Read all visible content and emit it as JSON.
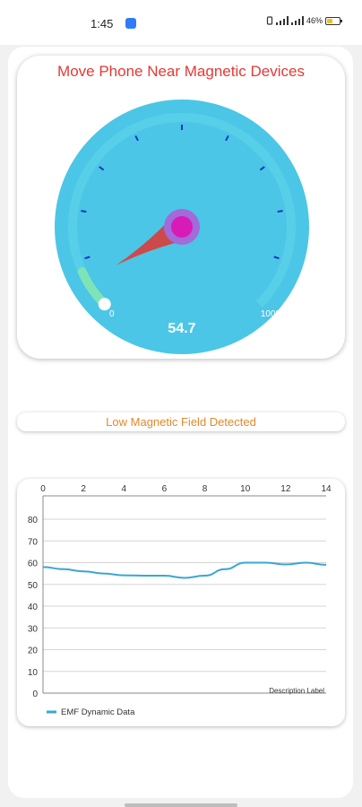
{
  "status_bar": {
    "time": "1:45",
    "battery_pct_label": "46%",
    "battery_level": 0.46
  },
  "header": {
    "title": "Move Phone Near Magnetic Devices"
  },
  "gauge": {
    "min_label": "0",
    "max_label": "1000",
    "value_label": "54.7",
    "value": 54.7,
    "min": 0,
    "max": 1000,
    "dial_color": "#4cc6e6",
    "needle_color": "#cd4a4a",
    "hub_color": "#d81bb8",
    "tick_color": "#1a35c9"
  },
  "detection": {
    "message": "Low Magnetic Field Detected"
  },
  "chart_data": {
    "type": "line",
    "title": "",
    "description_label": "Description Label",
    "x_ticks": [
      "0",
      "2",
      "4",
      "6",
      "8",
      "10",
      "12",
      "14"
    ],
    "y_ticks": [
      "0",
      "10",
      "20",
      "30",
      "40",
      "50",
      "60",
      "70",
      "80"
    ],
    "xlim": [
      0,
      14
    ],
    "ylim": [
      0,
      80
    ],
    "grid": true,
    "legend_position": "bottom-left",
    "series": [
      {
        "name": "EMF Dynamic Data",
        "color": "#3aa6d4",
        "x": [
          0,
          1,
          2,
          3,
          4,
          5,
          6,
          7,
          8,
          9,
          10,
          11,
          12,
          13,
          14
        ],
        "values": [
          58,
          57,
          56,
          55,
          54.2,
          54,
          54,
          53,
          54,
          57,
          60,
          60,
          59.2,
          60,
          59
        ]
      }
    ]
  }
}
